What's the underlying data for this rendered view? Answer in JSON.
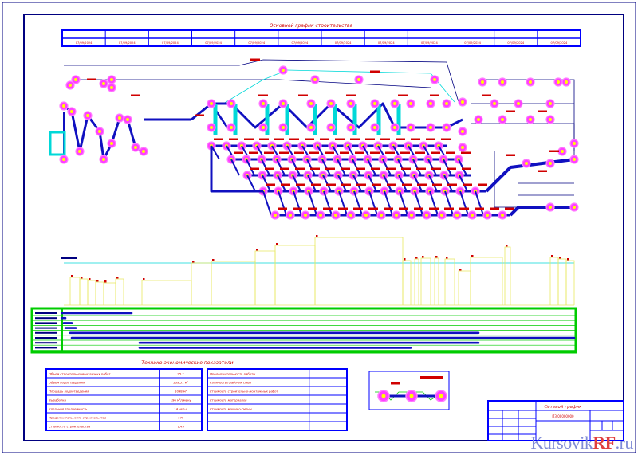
{
  "drawing": {
    "title": "Основной график строительства",
    "colors": {
      "frame": "#0000ff",
      "pipe": "#1010c0",
      "node_fill": "#ff40ff",
      "node_ring": "#ff80ff",
      "node_core": "#ffff00",
      "arrow": "#2020ff",
      "red": "#d00000",
      "cyan": "#00d8d8",
      "yellow": "#e8e860",
      "green": "#00cc00",
      "navy": "#000080"
    },
    "header_cells": [
      "07/09/2024",
      "07/09/2024",
      "07/09/2024",
      "07/09/2024",
      "07/09/2024",
      "07/09/2024",
      "07/09/2024",
      "07/09/2024",
      "07/09/2024",
      "07/09/2024",
      "07/09/2024",
      "07/09/2024"
    ],
    "bottom_table_title": "Технико-экономические показатели",
    "left_table": [
      {
        "label": "Объем строительно-монтажных работ",
        "value": "95 т"
      },
      {
        "label": "Объем водоотведения",
        "value": "239,51 м³"
      },
      {
        "label": "Площадь водоотведения",
        "value": "1098 м²"
      },
      {
        "label": "Выработка",
        "value": "196 м³/смену"
      },
      {
        "label": "Удельная трудоемкость",
        "value": "14 чел-ч"
      },
      {
        "label": "Продолжительность строительства",
        "value": "170"
      },
      {
        "label": "Стоимость строительства",
        "value": "1,45"
      }
    ],
    "right_table": [
      {
        "label": "Продолжительность работы",
        "value": ""
      },
      {
        "label": "Количество рабочих смен",
        "value": ""
      },
      {
        "label": "Стоимость строительно-монтажных работ",
        "value": ""
      },
      {
        "label": "Стоимость материалов",
        "value": ""
      },
      {
        "label": "Стоимость машино-смены",
        "value": ""
      }
    ],
    "title_block": {
      "name": "Сетевой график",
      "sub": "ПЗ 00000000"
    }
  },
  "watermark": {
    "a": "Kursovik",
    "b": "RF",
    ".ru": ".ru",
    "tail": ".ru"
  }
}
